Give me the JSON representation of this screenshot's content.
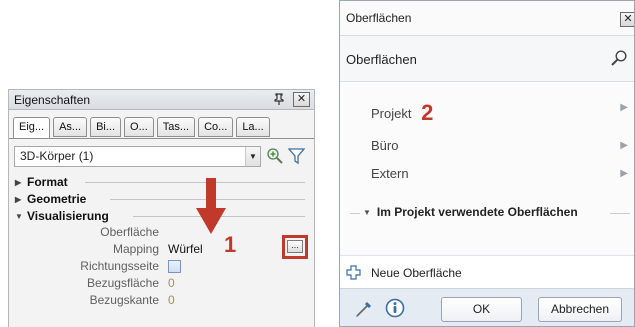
{
  "properties_panel": {
    "title": "Eigenschaften",
    "pin_glyph": "ᵖ",
    "close_glyph": "✕",
    "tabs": [
      "Eig...",
      "As...",
      "Bi...",
      "O...",
      "Tas...",
      "Co...",
      "La..."
    ],
    "object_selector": "3D-Körper (1)",
    "groups": [
      "Format",
      "Geometrie",
      "Visualisierung"
    ],
    "rows": [
      {
        "label": "Oberfläche",
        "value": ""
      },
      {
        "label": "Mapping",
        "value": "Würfel"
      },
      {
        "label": "Richtungsseite",
        "value": ""
      },
      {
        "label": "Bezugsfläche",
        "value": "0"
      },
      {
        "label": "Bezugskante",
        "value": "0"
      }
    ],
    "ellipsis_button": "..."
  },
  "annotations": {
    "step1": "1",
    "step2": "2"
  },
  "surfaces_dialog": {
    "title": "Oberflächen",
    "close_glyph": "✕",
    "header_title": "Oberflächen",
    "items": [
      "Projekt",
      "Büro",
      "Extern"
    ],
    "used_section": "Im Projekt verwendete Oberflächen",
    "new_surface": "Neue Oberfläche",
    "ok_label": "OK",
    "cancel_label": "Abbrechen"
  },
  "colors": {
    "annotation_red": "#c0392b",
    "footer_bg": "#e4ebf3"
  }
}
